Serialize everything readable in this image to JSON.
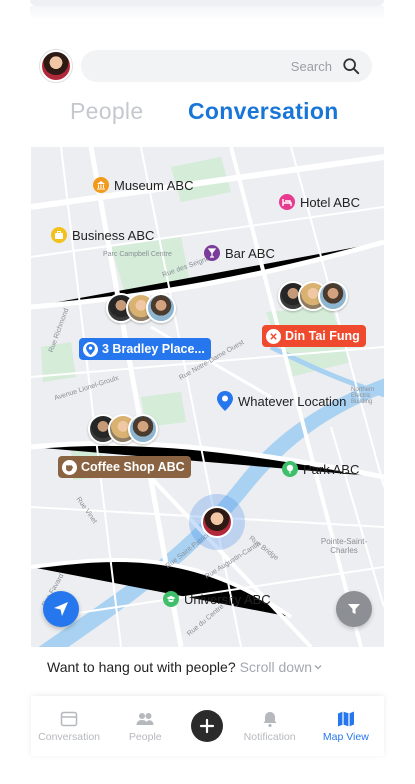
{
  "header": {
    "search_placeholder": "Search",
    "tabs": [
      {
        "label": "People",
        "active": false
      },
      {
        "label": "Conversation",
        "active": true
      }
    ]
  },
  "map": {
    "pois": [
      {
        "label": "Museum ABC",
        "icon": "museum-icon",
        "color": "#f29a1b"
      },
      {
        "label": "Hotel ABC",
        "icon": "hotel-icon",
        "color": "#e83a8f"
      },
      {
        "label": "Business ABC",
        "icon": "briefcase-icon",
        "color": "#f2c11b"
      },
      {
        "label": "Bar ABC",
        "icon": "bar-icon",
        "color": "#7a3d9a"
      },
      {
        "label": "Whatever Location",
        "icon": "location-pin-icon",
        "color": "#2677ee"
      },
      {
        "label": "Park ABC",
        "icon": "park-icon",
        "color": "#3fbf6a"
      },
      {
        "label": "University ABC",
        "icon": "graduation-icon",
        "color": "#3fbf6a"
      }
    ],
    "groups": [
      {
        "label": "3 Bradley Place...",
        "color": "#2677ee"
      },
      {
        "label": "Din Tai Fung",
        "color": "#ef4a2e"
      },
      {
        "label": "Coffee Shop ABC",
        "color": "#8a6342"
      }
    ],
    "street_labels": [
      "Parc Campbell Centre",
      "Rue des Seigneurs",
      "Rue Notre-Dame Ouest",
      "Avenue Lionel-Groulx",
      "Rue Saint-Patrick",
      "Rue Augustin-Cantin",
      "Rue Bridge",
      "Pointe-Saint-Charles",
      "Northern Electric Building",
      "Rue Richmond",
      "Rue Vinet",
      "Rue du Centre",
      "Rue Favard"
    ]
  },
  "prompt": {
    "question": "Want to hang out with people?",
    "scroll_label": "Scroll down"
  },
  "nav": {
    "items": [
      {
        "label": "Conversation",
        "active": false
      },
      {
        "label": "People",
        "active": false
      },
      {
        "label": "Notification",
        "active": false
      },
      {
        "label": "Map View",
        "active": true
      }
    ]
  }
}
